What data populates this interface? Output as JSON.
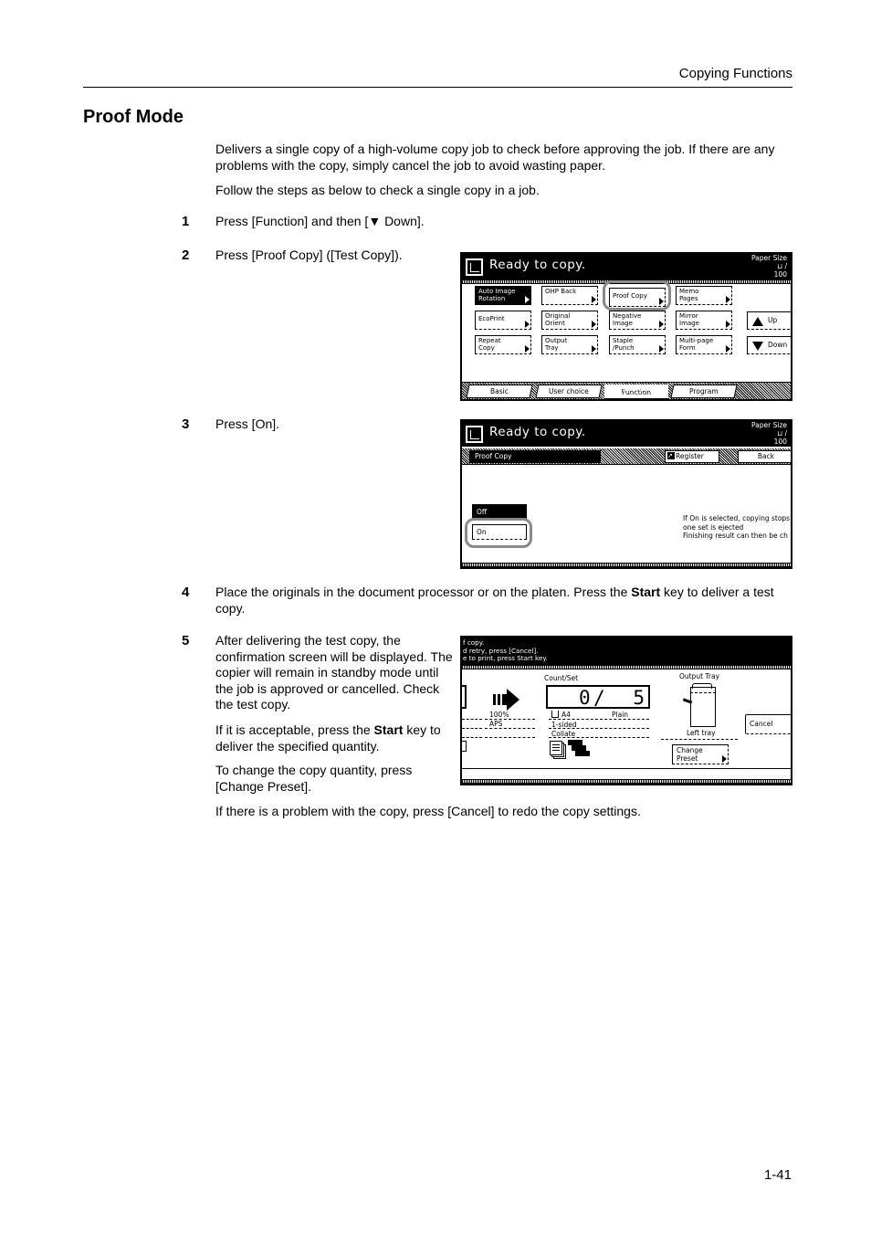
{
  "running_head": "Copying Functions",
  "section_title": "Proof Mode",
  "intro": {
    "p1": "Delivers a single copy of a high-volume copy job to check before approving the job. If there are any problems with the copy, simply cancel the job to avoid wasting paper.",
    "p2": "Follow the steps as below to check a single copy in a job."
  },
  "steps": [
    {
      "num": "1",
      "text": "Press [Function] and then [▼ Down]."
    },
    {
      "num": "2",
      "text": "Press [Proof Copy] ([Test Copy])."
    },
    {
      "num": "3",
      "text": "Press [On]."
    },
    {
      "num": "4",
      "text_pre": "Place the originals in the document processor or on the platen. Press the ",
      "bold": "Start",
      "text_post": " key to deliver a test copy."
    },
    {
      "num": "5",
      "text": "After delivering the test copy, the confirmation screen will be displayed. The copier will remain in standby mode until the job is approved or cancelled. Check the test copy.",
      "p2_pre": "If it is acceptable, press the ",
      "p2_bold": "Start",
      "p2_post": " key to deliver the specified quantity.",
      "p3": "To change the copy quantity, press [Change Preset].",
      "p4": "If there is a problem with the copy, press [Cancel] to redo the copy settings."
    }
  ],
  "panel1": {
    "status": "Ready to copy.",
    "paper_size_label": "Paper Size",
    "paper_size_value": "⊔ /",
    "zoom_value": "100",
    "buttons": [
      {
        "l1": "Auto Image",
        "l2": "Rotation",
        "selected": true
      },
      {
        "l1": "OHP Back",
        "l2": ""
      },
      {
        "l1": "Proof Copy",
        "l2": "",
        "highlighted": true
      },
      {
        "l1": "Memo",
        "l2": "Pages"
      },
      {
        "l1": "EcoPrint",
        "l2": ""
      },
      {
        "l1": "Original",
        "l2": "Orient"
      },
      {
        "l1": "Negative",
        "l2": "Image"
      },
      {
        "l1": "Mirror",
        "l2": "Image"
      },
      {
        "l1": "Repeat",
        "l2": "Copy"
      },
      {
        "l1": "Output",
        "l2": "Tray"
      },
      {
        "l1": "Staple",
        "l2": "/Punch"
      },
      {
        "l1": "Multi-page",
        "l2": "Form"
      }
    ],
    "up_label": "Up",
    "down_label": "Down",
    "tabs": [
      "Basic",
      "User choice",
      "Function",
      "Program"
    ],
    "active_tab": "Function"
  },
  "panel2": {
    "status": "Ready to copy.",
    "paper_size_label": "Paper Size",
    "paper_size_value": "⊔ /",
    "zoom_value": "100",
    "function_title": "Proof Copy",
    "register_label": "Register",
    "back_label": "Back",
    "options": [
      {
        "label": "Off",
        "selected": true
      },
      {
        "label": "On",
        "highlighted": true
      }
    ],
    "description": [
      "If On is selected, copying stops",
      "one set is ejected",
      "Finishing result can then be ch"
    ]
  },
  "panel3": {
    "messages": [
      "f copy.",
      "d retry, press [Cancel].",
      "e to print, press Start key."
    ],
    "count_set_label": "Count/Set",
    "count_done": "0",
    "count_total": "5",
    "zoom_pct": "100%",
    "paper_mode": "APS",
    "paper_size": "A4",
    "paper_type": "Plain",
    "sides": "1-sided",
    "finish": "Collate",
    "output_tray_label": "Output Tray",
    "output_tray_value": "Left tray",
    "cancel_label": "Cancel",
    "change_preset_l1": "Change",
    "change_preset_l2": "Preset"
  },
  "page_number": "1-41"
}
